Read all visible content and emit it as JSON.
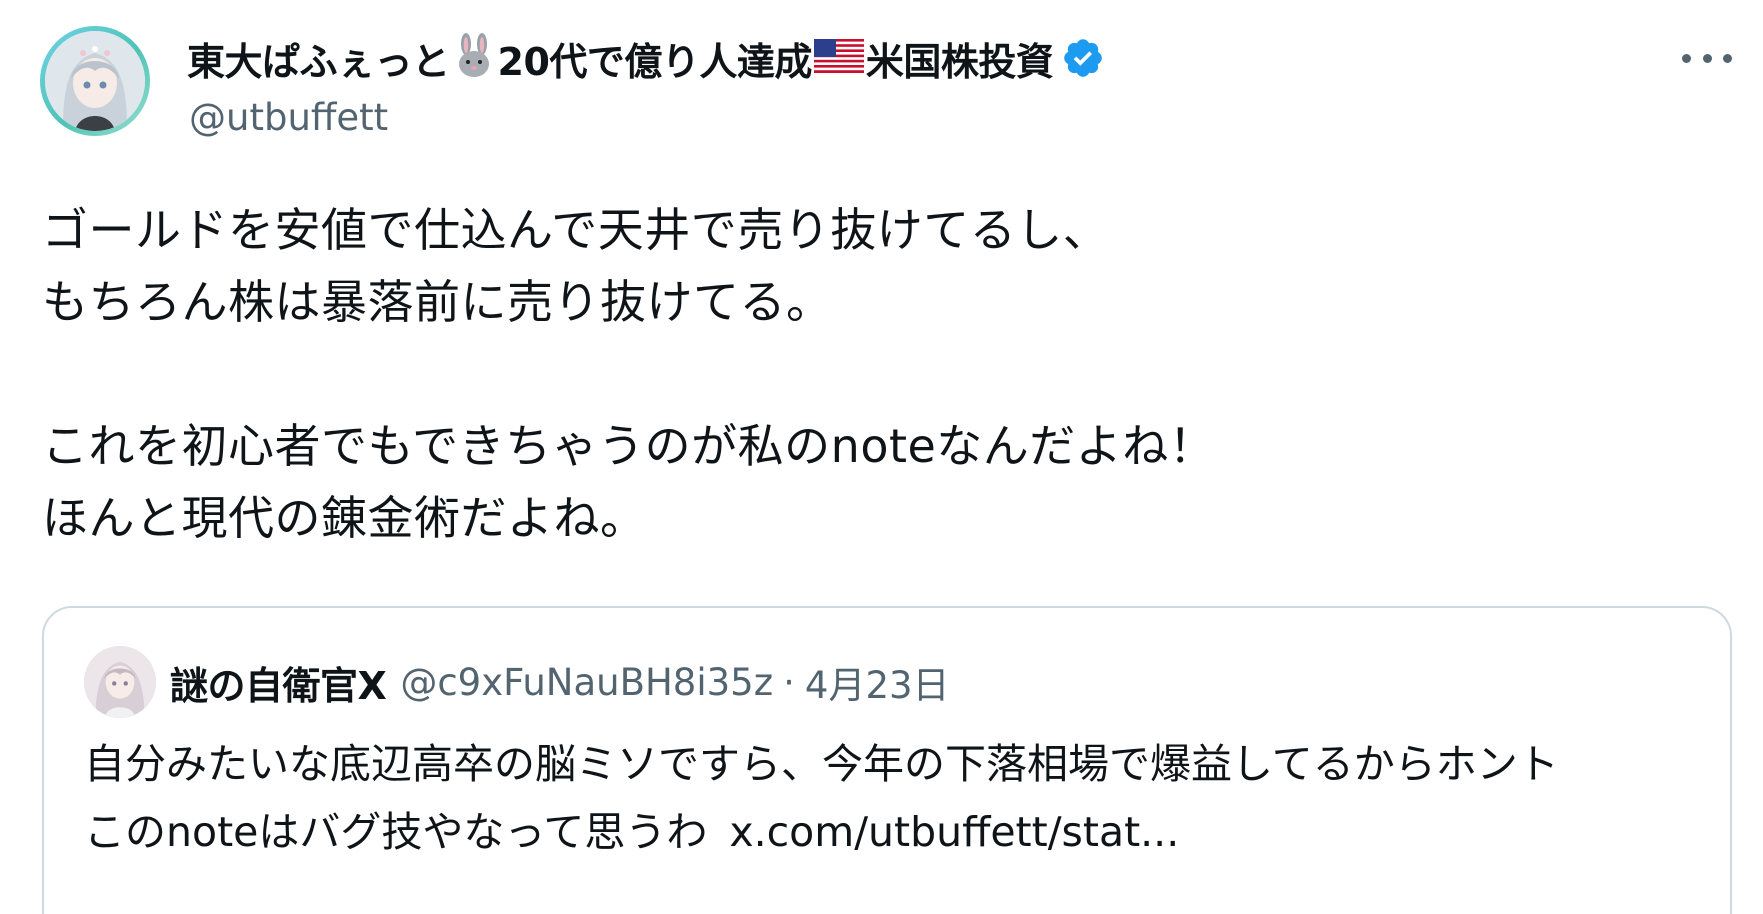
{
  "author": {
    "name_part1": "東大ぱふぇっと",
    "name_part2": "20代で億り人達成",
    "name_part3": "米国株投資",
    "handle": "@utbuffett"
  },
  "tweet": {
    "lines": [
      "ゴールドを安値で仕込んで天井で売り抜けてるし、",
      "もちろん株は暴落前に売り抜けてる。",
      "これを初心者でもできちゃうのが私のnoteなんだよね！",
      "ほんと現代の錬金術だよね。"
    ]
  },
  "quoted": {
    "name": "謎の自衛官X",
    "handle": "@c9xFuNauBH8i35z",
    "separator": "·",
    "date": "4月23日",
    "line1": "自分みたいな底辺高卒の脳ミソですら、今年の下落相場で爆益してるからホント",
    "line2": "このnoteはバグ技やなって思うわ",
    "link": "x.com/utbuffett/stat..."
  },
  "icons": {
    "rabbit": "rabbit-face-emoji",
    "flag": "us-flag-emoji",
    "verified": "verified-badge-icon",
    "more": "more-horizontal-icon"
  },
  "colors": {
    "text": "#0f1419",
    "secondary": "#536471",
    "verified": "#1d9bf0",
    "border": "#cfd9de"
  }
}
